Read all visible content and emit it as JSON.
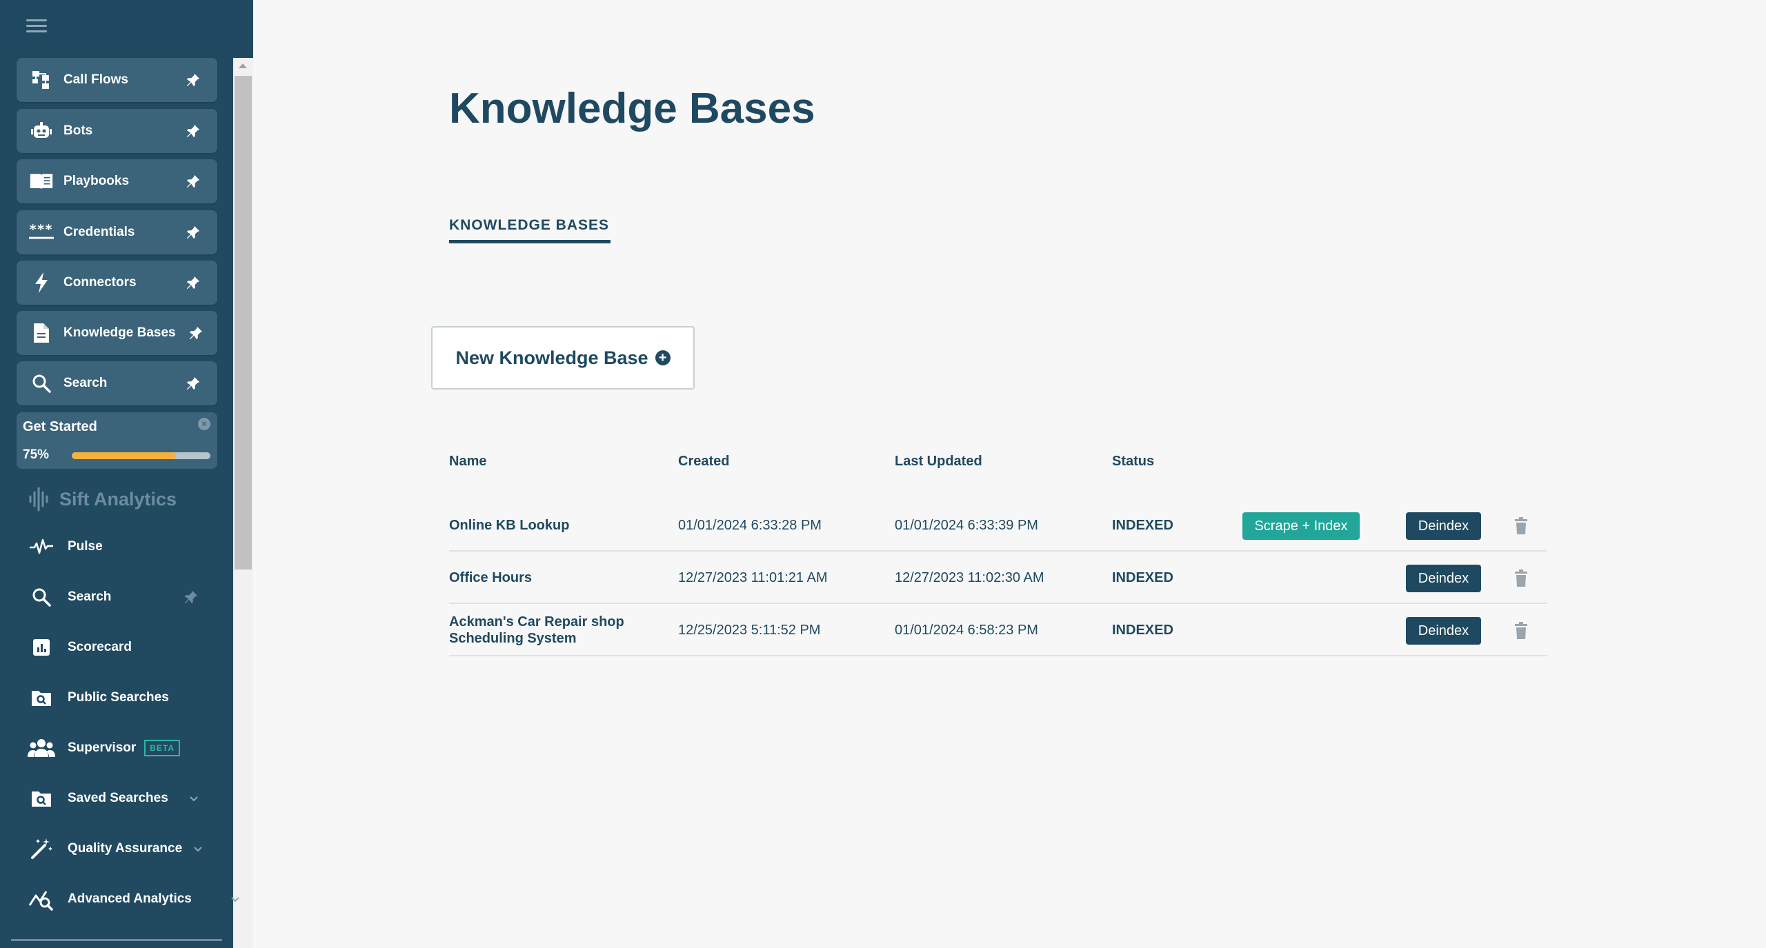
{
  "sidebar": {
    "pinned": [
      {
        "label": "Call Flows",
        "icon": "call-flows-icon"
      },
      {
        "label": "Bots",
        "icon": "bot-icon"
      },
      {
        "label": "Playbooks",
        "icon": "book-icon"
      },
      {
        "label": "Credentials",
        "icon": "asterisks-icon"
      },
      {
        "label": "Connectors",
        "icon": "lightning-icon"
      },
      {
        "label": "Knowledge Bases",
        "icon": "document-icon"
      },
      {
        "label": "Search",
        "icon": "search-icon"
      }
    ],
    "get_started": {
      "title": "Get Started",
      "percent_label": "75%",
      "progress": 0.75
    },
    "section_title": "Sift Analytics",
    "nav": [
      {
        "label": "Pulse",
        "icon": "pulse-icon"
      },
      {
        "label": "Search",
        "icon": "search-icon"
      },
      {
        "label": "Scorecard",
        "icon": "scorecard-icon"
      },
      {
        "label": "Public Searches",
        "icon": "folder-search-icon"
      },
      {
        "label": "Supervisor",
        "icon": "users-icon",
        "badge": "BETA"
      },
      {
        "label": "Saved Searches",
        "icon": "folder-search-icon"
      },
      {
        "label": "Quality Assurance",
        "icon": "magic-wand-icon"
      },
      {
        "label": "Advanced Analytics",
        "icon": "chart-search-icon"
      }
    ]
  },
  "main": {
    "title": "Knowledge Bases",
    "tab": "KNOWLEDGE BASES",
    "new_button": "New Knowledge Base",
    "columns": [
      "Name",
      "Created",
      "Last Updated",
      "Status"
    ],
    "rows": [
      {
        "name": "Online KB Lookup",
        "created": "01/01/2024 6:33:28 PM",
        "updated": "01/01/2024 6:33:39 PM",
        "status": "INDEXED",
        "scrape_label": "Scrape + Index",
        "deindex_label": "Deindex"
      },
      {
        "name": "Office Hours",
        "created": "12/27/2023 11:01:21 AM",
        "updated": "12/27/2023 11:02:30 AM",
        "status": "INDEXED",
        "deindex_label": "Deindex"
      },
      {
        "name": "Ackman's Car Repair shop Scheduling System",
        "created": "12/25/2023 5:11:52 PM",
        "updated": "01/01/2024 6:58:23 PM",
        "status": "INDEXED",
        "deindex_label": "Deindex"
      }
    ]
  },
  "colors": {
    "sidebar": "#1f4960",
    "card": "#3b6379",
    "accent": "#22a699",
    "progress": "#f4b23c"
  }
}
